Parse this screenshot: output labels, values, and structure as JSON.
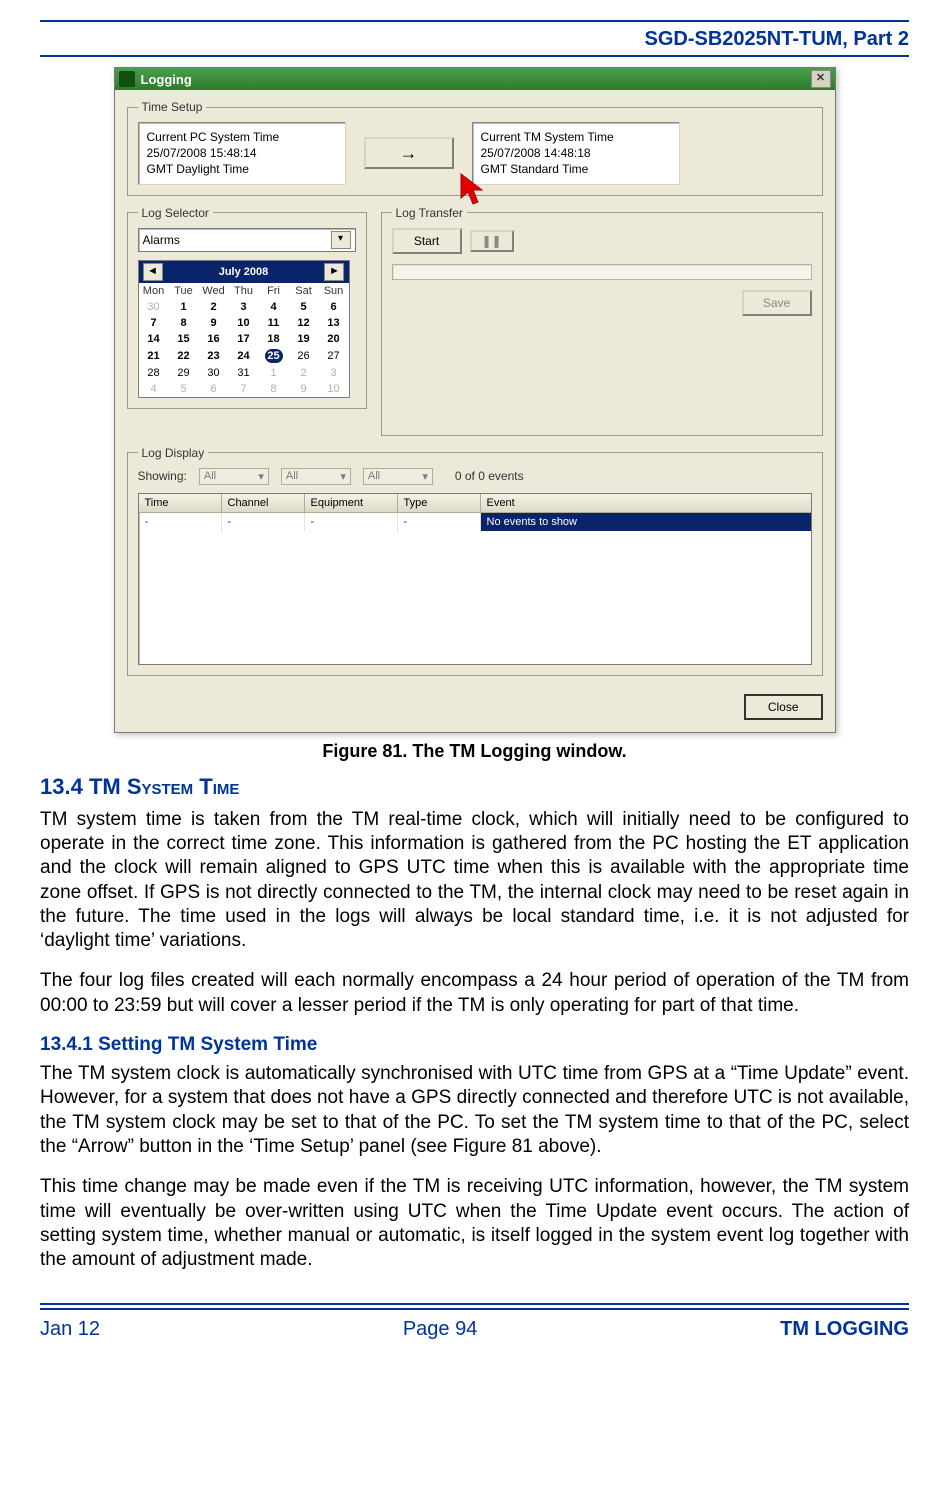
{
  "doc": {
    "header": "SGD-SB2025NT-TUM, Part 2",
    "footer_left": "Jan 12",
    "footer_center": "Page 94",
    "footer_right": "TM LOGGING"
  },
  "figure": {
    "caption": "Figure 81.  The TM Logging window."
  },
  "window": {
    "title": "Logging",
    "close_glyph": "✕",
    "time_setup": {
      "legend": "Time Setup",
      "pc": {
        "header": "Current PC System Time",
        "timestamp": "25/07/2008 15:48:14",
        "tz": "GMT Daylight Time"
      },
      "arrow_glyph": "→",
      "tm": {
        "header": "Current TM System Time",
        "timestamp": "25/07/2008 14:48:18",
        "tz": "GMT Standard Time"
      }
    },
    "log_selector": {
      "legend": "Log Selector",
      "dropdown_value": "Alarms",
      "prev_glyph": "◄",
      "month_label": "July 2008",
      "next_glyph": "►",
      "dow": [
        "Mon",
        "Tue",
        "Wed",
        "Thu",
        "Fri",
        "Sat",
        "Sun"
      ],
      "weeks": [
        [
          {
            "d": "30",
            "dim": true
          },
          {
            "d": "1",
            "bold": true
          },
          {
            "d": "2",
            "bold": true
          },
          {
            "d": "3",
            "bold": true
          },
          {
            "d": "4",
            "bold": true
          },
          {
            "d": "5",
            "bold": true
          },
          {
            "d": "6",
            "bold": true
          }
        ],
        [
          {
            "d": "7",
            "bold": true
          },
          {
            "d": "8",
            "bold": true
          },
          {
            "d": "9",
            "bold": true
          },
          {
            "d": "10",
            "bold": true
          },
          {
            "d": "11",
            "bold": true
          },
          {
            "d": "12",
            "bold": true
          },
          {
            "d": "13",
            "bold": true
          }
        ],
        [
          {
            "d": "14",
            "bold": true
          },
          {
            "d": "15",
            "bold": true
          },
          {
            "d": "16",
            "bold": true
          },
          {
            "d": "17",
            "bold": true
          },
          {
            "d": "18",
            "bold": true
          },
          {
            "d": "19",
            "bold": true
          },
          {
            "d": "20",
            "bold": true
          }
        ],
        [
          {
            "d": "21",
            "bold": true
          },
          {
            "d": "22",
            "bold": true
          },
          {
            "d": "23",
            "bold": true
          },
          {
            "d": "24",
            "bold": true
          },
          {
            "d": "25",
            "today": true
          },
          {
            "d": "26"
          },
          {
            "d": "27"
          }
        ],
        [
          {
            "d": "28"
          },
          {
            "d": "29"
          },
          {
            "d": "30"
          },
          {
            "d": "31"
          },
          {
            "d": "1",
            "dim": true
          },
          {
            "d": "2",
            "dim": true
          },
          {
            "d": "3",
            "dim": true
          }
        ],
        [
          {
            "d": "4",
            "dim": true
          },
          {
            "d": "5",
            "dim": true
          },
          {
            "d": "6",
            "dim": true
          },
          {
            "d": "7",
            "dim": true
          },
          {
            "d": "8",
            "dim": true
          },
          {
            "d": "9",
            "dim": true
          },
          {
            "d": "10",
            "dim": true
          }
        ]
      ]
    },
    "log_transfer": {
      "legend": "Log Transfer",
      "start_label": "Start",
      "pause_glyph": "❚❚",
      "save_label": "Save"
    },
    "log_display": {
      "legend": "Log Display",
      "showing_label": "Showing:",
      "filter_value": "All",
      "count_text": "0 of 0 events",
      "columns": [
        "Time",
        "Channel",
        "Equipment",
        "Type",
        "Event"
      ],
      "row": {
        "time": "-",
        "channel": "-",
        "equipment": "-",
        "type": "-",
        "event": "No events to show"
      }
    },
    "close_button": "Close",
    "dd_arrow": "▾"
  },
  "text": {
    "h_section_num": "13.4",
    "h_section_rest": "  TM System Time",
    "p1": "TM system time is taken from the TM real-time clock, which will initially need to be configured to operate in the correct time zone.  This information is gathered from the PC hosting the ET application and the clock will remain aligned to GPS UTC time when this is available with the appropriate time zone offset.  If GPS is not directly connected to the TM, the internal clock may need to be reset again in the future.  The time used in the logs will always be local standard time, i.e. it is not adjusted for ‘daylight time’ variations.",
    "p2": "The four log files created will each normally encompass a 24 hour period of operation of the TM from 00:00 to 23:59 but will cover a lesser period if the TM is only operating for part of that time.",
    "h_sub": "13.4.1   Setting TM System Time",
    "p3": "The TM system clock is automatically synchronised with UTC time from GPS at a “Time Update” event.  However, for a system that does not have a GPS directly connected and therefore UTC is not available, the TM system clock may be set to that of the PC.  To set the TM system time to that of the PC, select the “Arrow” button in the ‘Time Setup’ panel (see Figure 81 above).",
    "p4": "This time change may be made even if the TM is receiving UTC information, however, the TM system time will eventually be over-written using UTC when the Time Update event occurs.  The action of setting system time, whether manual or automatic, is itself logged in the system event log together with the amount of adjustment made."
  }
}
